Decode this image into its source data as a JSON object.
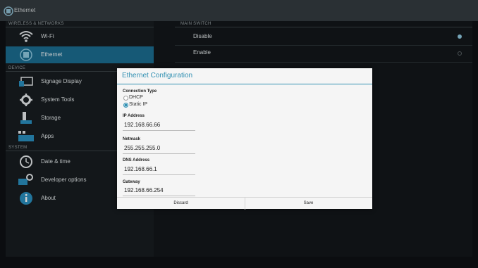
{
  "window": {
    "title": "Ethernet"
  },
  "sidebar": {
    "sections": [
      {
        "label": "WIRELESS & NETWORKS"
      },
      {
        "label": "DEVICE"
      },
      {
        "label": "SYSTEM"
      }
    ],
    "items": [
      {
        "label": "Wi-Fi",
        "icon": "wifi-icon"
      },
      {
        "label": "Ethernet",
        "icon": "ethernet-icon",
        "active": true
      },
      {
        "label": "Signage Display",
        "icon": "display-icon"
      },
      {
        "label": "System Tools",
        "icon": "gear-icon"
      },
      {
        "label": "Storage",
        "icon": "storage-icon"
      },
      {
        "label": "Apps",
        "icon": "apps-icon"
      },
      {
        "label": "Date & time",
        "icon": "clock-icon"
      },
      {
        "label": "Developer options",
        "icon": "developer-icon"
      },
      {
        "label": "About",
        "icon": "info-icon"
      }
    ]
  },
  "main_switch": {
    "header": "MAIN SWITCH",
    "options": [
      {
        "label": "Disable",
        "selected": true
      },
      {
        "label": "Enable",
        "selected": false
      }
    ]
  },
  "dialog": {
    "title": "Ethernet Configuration",
    "connection_type": {
      "label": "Connection Type",
      "options": [
        {
          "label": "DHCP",
          "selected": false
        },
        {
          "label": "Static IP",
          "selected": true
        }
      ]
    },
    "fields": [
      {
        "label": "IP Address",
        "value": "192.168.66.66"
      },
      {
        "label": "Netmask",
        "value": "255.255.255.0"
      },
      {
        "label": "DNS Address",
        "value": "192.168.66.1"
      },
      {
        "label": "Gateway",
        "value": "192.168.66.254"
      }
    ],
    "buttons": {
      "discard": "Discard",
      "save": "Save"
    }
  },
  "colors": {
    "accent": "#3391b3",
    "active_item": "#1c6d91"
  }
}
